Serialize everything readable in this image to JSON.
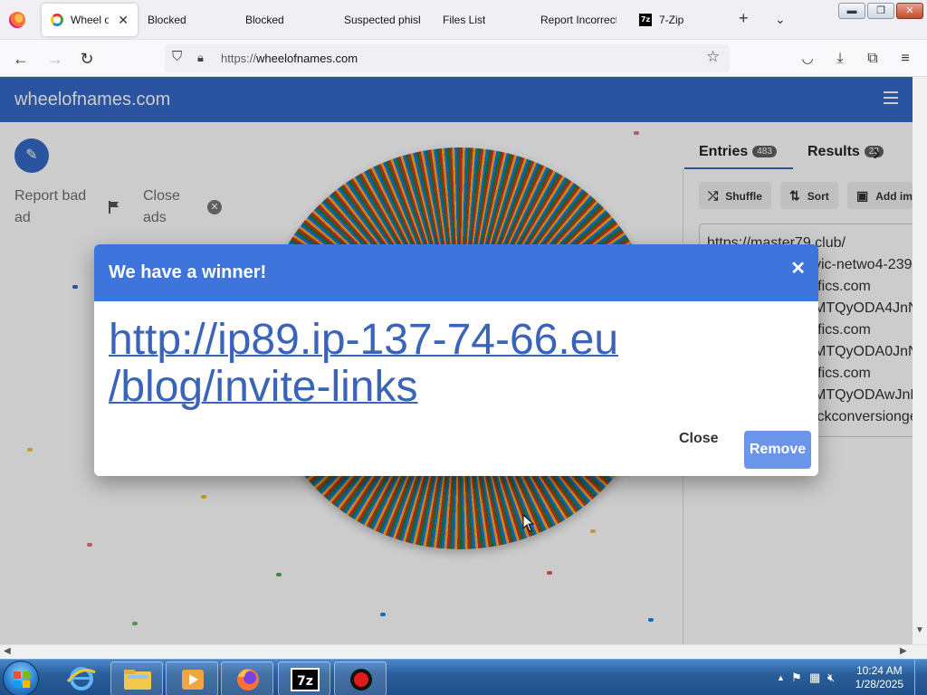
{
  "browser": {
    "tabs": [
      {
        "label": "Wheel of",
        "active": true,
        "icon": "wheel-favicon"
      },
      {
        "label": "Blocked",
        "active": false
      },
      {
        "label": "Blocked",
        "active": false
      },
      {
        "label": "Suspected phish",
        "active": false
      },
      {
        "label": "Files List",
        "active": false
      },
      {
        "label": "Report Incorrect",
        "active": false
      },
      {
        "label": "7-Zip",
        "active": false,
        "icon": "7zip-favicon"
      }
    ],
    "url_scheme": "https://",
    "url_host": "wheelofnames.com"
  },
  "site": {
    "title": "wheelofnames.com",
    "report_bad_ad": "Report bad ad",
    "close_ads": "Close ads"
  },
  "panel": {
    "entries_label": "Entries",
    "entries_count": "483",
    "results_label": "Results",
    "results_count": "23",
    "shuffle_label": "Shuffle",
    "sort_label": "Sort",
    "add_image_label": "Add ima",
    "entries": [
      "https://master79.club/",
      "vic-netwo4-239",
      "ffics.com",
      "MTQyODA4JnNI",
      "ffics.com",
      "MTQyODA0JnNI",
      "ffics.com",
      "MTQyODAwJnNI",
      "ickconversionge"
    ]
  },
  "dialog": {
    "title": "We have a winner!",
    "winner_line1": "http://ip89.ip-137-74-66.eu",
    "winner_line2": "/blog/invite-links",
    "close_label": "Close",
    "remove_label": "Remove"
  },
  "taskbar": {
    "time": "10:24 AM",
    "date": "1/28/2025",
    "pinned": [
      "internet-explorer-icon",
      "file-explorer-icon",
      "media-player-icon",
      "firefox-icon",
      "7zip-icon",
      "record-icon"
    ]
  },
  "colors": {
    "brand_blue": "#3669c9",
    "dialog_header": "#3e75dd",
    "remove_button": "#6b95e8",
    "winner_text": "#3a64b8"
  }
}
